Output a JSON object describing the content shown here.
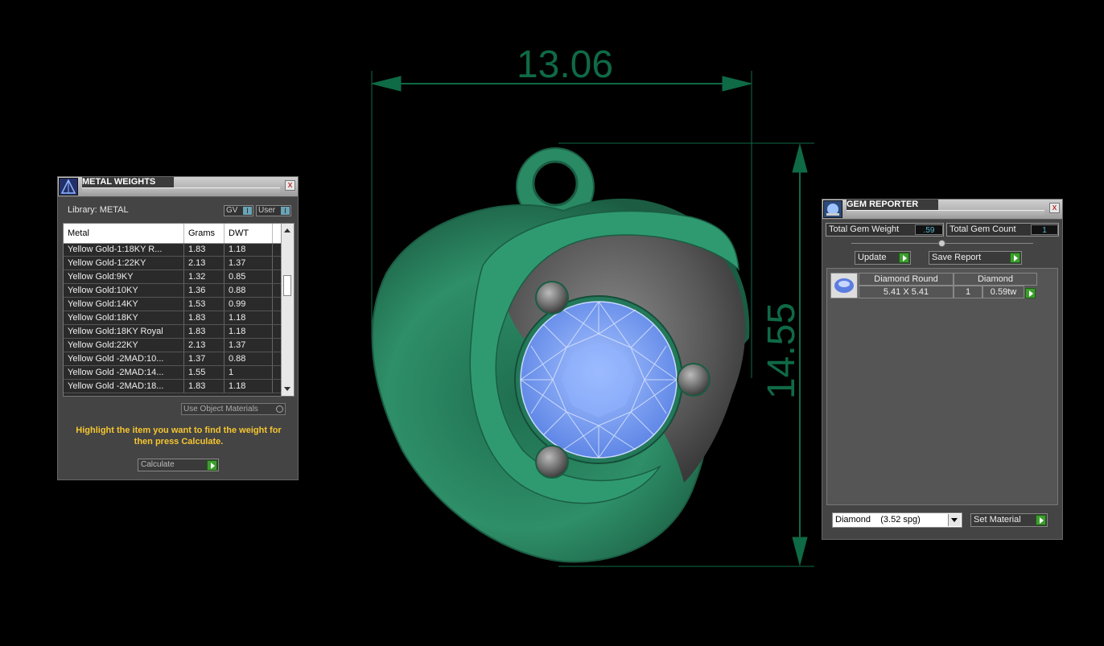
{
  "dimensions": {
    "width_label": "13.06",
    "height_label": "14.55"
  },
  "metal_weights": {
    "title": "METAL WEIGHTS",
    "close": "x",
    "library_label": "Library: METAL",
    "gv_label": "GV",
    "user_label": "User",
    "toggle_glyph": "I",
    "columns": [
      "Metal",
      "Grams",
      "DWT"
    ],
    "rows": [
      {
        "metal": "Yellow Gold-1:18KY R...",
        "grams": "1.83",
        "dwt": "1.18"
      },
      {
        "metal": "Yellow Gold-1:22KY",
        "grams": "2.13",
        "dwt": "1.37"
      },
      {
        "metal": "Yellow Gold:9KY",
        "grams": "1.32",
        "dwt": "0.85"
      },
      {
        "metal": "Yellow Gold:10KY",
        "grams": "1.36",
        "dwt": "0.88"
      },
      {
        "metal": "Yellow Gold:14KY",
        "grams": "1.53",
        "dwt": "0.99"
      },
      {
        "metal": "Yellow Gold:18KY",
        "grams": "1.83",
        "dwt": "1.18"
      },
      {
        "metal": "Yellow Gold:18KY Royal",
        "grams": "1.83",
        "dwt": "1.18"
      },
      {
        "metal": "Yellow Gold:22KY",
        "grams": "2.13",
        "dwt": "1.37"
      },
      {
        "metal": "Yellow Gold -2MAD:10...",
        "grams": "1.37",
        "dwt": "0.88"
      },
      {
        "metal": "Yellow Gold -2MAD:14...",
        "grams": "1.55",
        "dwt": "1"
      },
      {
        "metal": "Yellow Gold -2MAD:18...",
        "grams": "1.83",
        "dwt": "1.18"
      }
    ],
    "use_object_materials": "Use Object Materials",
    "instruction": "Highlight the item you want to find the weight for then press Calculate.",
    "calculate_label": "Calculate"
  },
  "gem_reporter": {
    "title": "GEM REPORTER",
    "close": "x",
    "total_weight_label": "Total Gem Weight",
    "total_weight_value": ".59",
    "total_count_label": "Total Gem Count",
    "total_count_value": "1",
    "update_label": "Update",
    "save_report_label": "Save Report",
    "gem": {
      "shape": "Diamond Round",
      "size": "5.41 X 5.41",
      "material": "Diamond",
      "count": "1",
      "weight": "0.59tw"
    },
    "material_select": "Diamond    (3.52 spg)",
    "set_material_label": "Set Material"
  },
  "colors": {
    "dimension": "#0f6a46",
    "metal": "#2e8f68",
    "gem": "#6f9bf2",
    "accent_green": "#3d9e2e"
  }
}
